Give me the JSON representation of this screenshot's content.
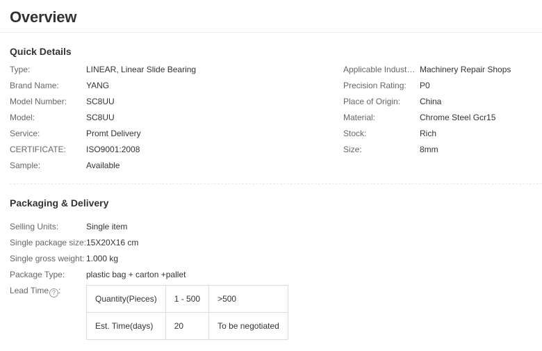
{
  "page_title": "Overview",
  "quick_details": {
    "title": "Quick Details",
    "left": [
      {
        "label": "Type:",
        "value": "LINEAR, Linear Slide Bearing"
      },
      {
        "label": "Brand Name:",
        "value": "YANG"
      },
      {
        "label": "Model Number:",
        "value": "SC8UU"
      },
      {
        "label": "Model:",
        "value": "SC8UU"
      },
      {
        "label": "Service:",
        "value": "Promt Delivery"
      },
      {
        "label": "CERTIFICATE:",
        "value": "ISO9001:2008"
      },
      {
        "label": "Sample:",
        "value": "Available"
      }
    ],
    "right": [
      {
        "label": "Applicable Industri...",
        "value": "Machinery Repair Shops"
      },
      {
        "label": "Precision Rating:",
        "value": "P0"
      },
      {
        "label": "Place of Origin:",
        "value": "China"
      },
      {
        "label": "Material:",
        "value": "Chrome Steel Gcr15"
      },
      {
        "label": "Stock:",
        "value": "Rich"
      },
      {
        "label": "Size:",
        "value": "8mm"
      }
    ]
  },
  "packaging": {
    "title": "Packaging & Delivery",
    "items": [
      {
        "label": "Selling Units:",
        "value": "Single item"
      },
      {
        "label": "Single package size:",
        "value": "15X20X16 cm"
      },
      {
        "label": "Single gross weight:",
        "value": "1.000 kg"
      },
      {
        "label": "Package Type:",
        "value": "plastic bag + carton +pallet"
      }
    ],
    "lead_time": {
      "label": "Lead Time",
      "help_glyph": "?",
      "colon": ":",
      "rows": [
        [
          "Quantity(Pieces)",
          "1 - 500",
          ">500"
        ],
        [
          "Est. Time(days)",
          "20",
          "To be negotiated"
        ]
      ]
    }
  }
}
